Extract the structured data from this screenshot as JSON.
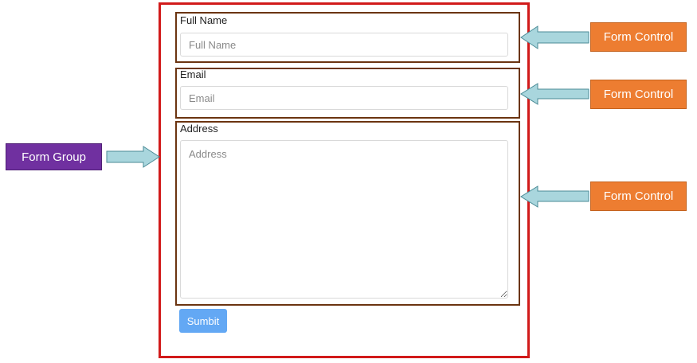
{
  "form": {
    "full_name": {
      "label": "Full Name",
      "placeholder": "Full Name"
    },
    "email": {
      "label": "Email",
      "placeholder": "Email"
    },
    "address": {
      "label": "Address",
      "placeholder": "Address"
    },
    "submit_label": "Sumbit"
  },
  "annotations": {
    "form_group_label": "Form Group",
    "form_control_labels": [
      "Form Control",
      "Form Control",
      "Form Control"
    ]
  },
  "colors": {
    "form_group_border": "#d11a1a",
    "form_control_border": "#6b3410",
    "form_control_tag": "#ed7d31",
    "form_group_tag": "#7030a0",
    "arrow_fill": "#a9d6dd",
    "submit_button": "#63a8f4"
  }
}
